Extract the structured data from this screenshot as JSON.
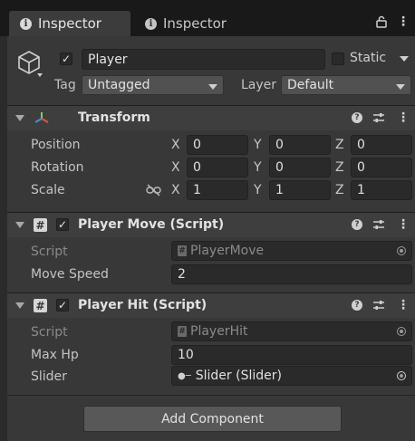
{
  "tabs": [
    {
      "label": "Inspector",
      "icon": "info-icon",
      "active": true
    },
    {
      "label": "Inspector",
      "icon": "info-icon",
      "active": false
    }
  ],
  "gameobject": {
    "active_checked": true,
    "name": "Player",
    "static_label": "Static",
    "tag_label": "Tag",
    "tag_value": "Untagged",
    "layer_label": "Layer",
    "layer_value": "Default"
  },
  "transform": {
    "title": "Transform",
    "rows": [
      {
        "label": "Position",
        "x": "0",
        "y": "0",
        "z": "0"
      },
      {
        "label": "Rotation",
        "x": "0",
        "y": "0",
        "z": "0"
      },
      {
        "label": "Scale",
        "x": "1",
        "y": "1",
        "z": "1"
      }
    ],
    "axis_labels": [
      "X",
      "Y",
      "Z"
    ]
  },
  "player_move": {
    "title": "Player Move (Script)",
    "script_label": "Script",
    "script_value": "PlayerMove",
    "speed_label": "Move Speed",
    "speed_value": "2"
  },
  "player_hit": {
    "title": "Player Hit (Script)",
    "script_label": "Script",
    "script_value": "PlayerHit",
    "maxhp_label": "Max Hp",
    "maxhp_value": "10",
    "slider_label": "Slider",
    "slider_value": "Slider (Slider)"
  },
  "add_component_label": "Add Component",
  "colors": {
    "background": "#383838",
    "tabbar": "#191919",
    "field": "#2a2a2a",
    "button": "#585858"
  }
}
